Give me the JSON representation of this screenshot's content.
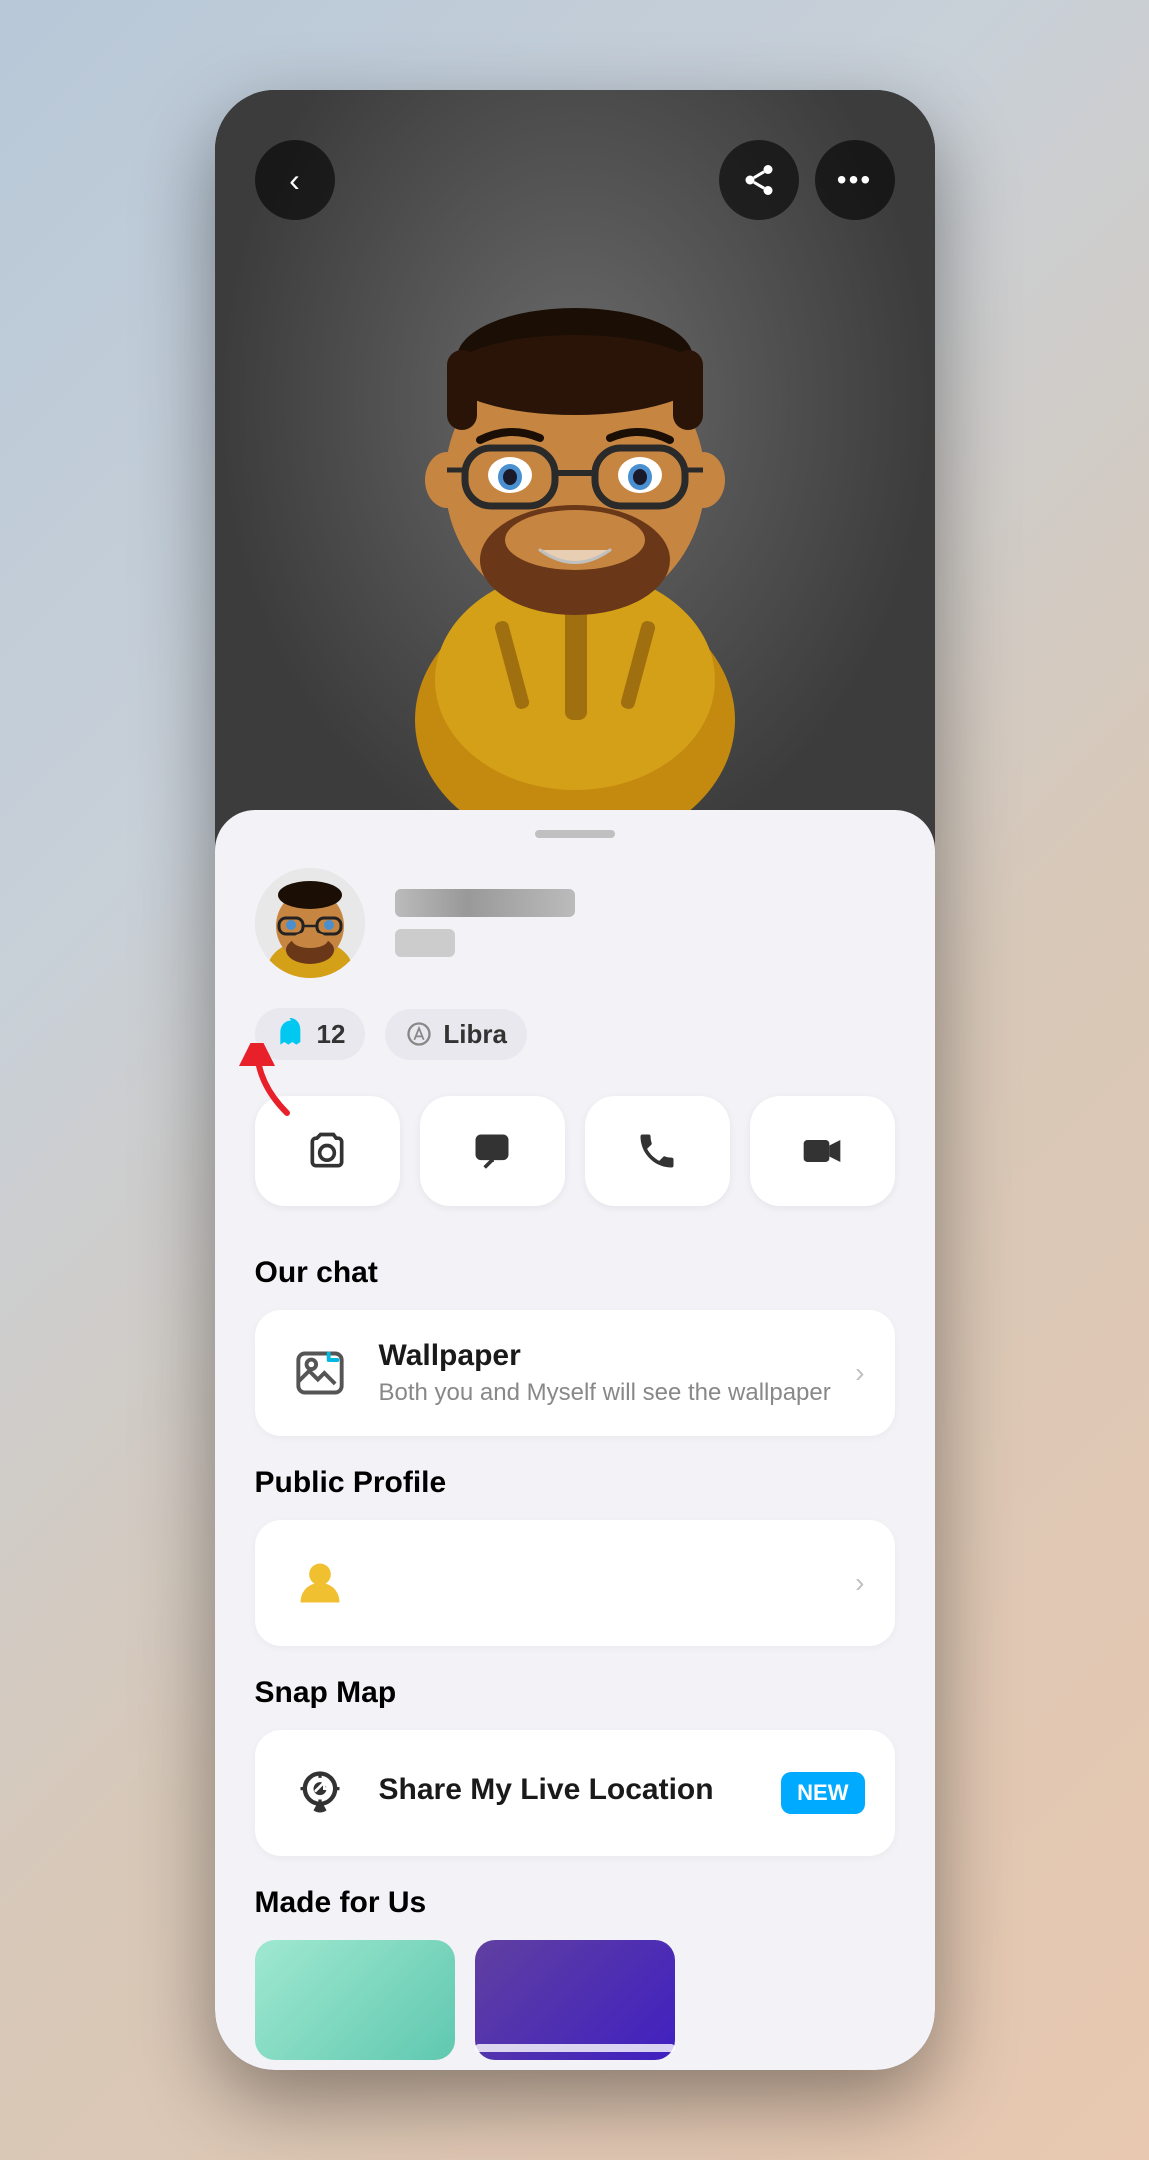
{
  "phone": {
    "avatar": {
      "alt": "3D bitmoji avatar with glasses and yellow hoodie"
    },
    "topNav": {
      "backLabel": "‹",
      "shareLabel": "⋯",
      "moreLabel": "⋯"
    },
    "profile": {
      "snapcountLabel": "12",
      "zodiacLabel": "Libra",
      "usernameBlurLine1": "",
      "usernameBlurLine2": ""
    },
    "actions": [
      {
        "id": "camera",
        "icon": "📷",
        "label": "Camera"
      },
      {
        "id": "chat",
        "icon": "💬",
        "label": "Chat"
      },
      {
        "id": "call",
        "icon": "📞",
        "label": "Call"
      },
      {
        "id": "video",
        "icon": "📹",
        "label": "Video"
      }
    ],
    "sections": [
      {
        "id": "our-chat",
        "label": "Our chat",
        "items": [
          {
            "id": "wallpaper",
            "icon": "🖼",
            "title": "Wallpaper",
            "subtitle": "Both you and Myself will see the wallpaper",
            "hasChevron": true
          }
        ]
      },
      {
        "id": "public-profile",
        "label": "Public Profile",
        "items": [
          {
            "id": "public-profile-item",
            "icon": "👤",
            "iconType": "person",
            "title": "",
            "subtitle": "",
            "hasChevron": true
          }
        ]
      },
      {
        "id": "snap-map",
        "label": "Snap Map",
        "items": [
          {
            "id": "live-location",
            "icon": "📍",
            "iconType": "location",
            "title": "Share My Live Location",
            "subtitle": "",
            "hasChevron": false,
            "badge": "NEW"
          }
        ]
      },
      {
        "id": "made-for-us",
        "label": "Made for Us",
        "items": []
      }
    ],
    "homeIndicator": ""
  }
}
